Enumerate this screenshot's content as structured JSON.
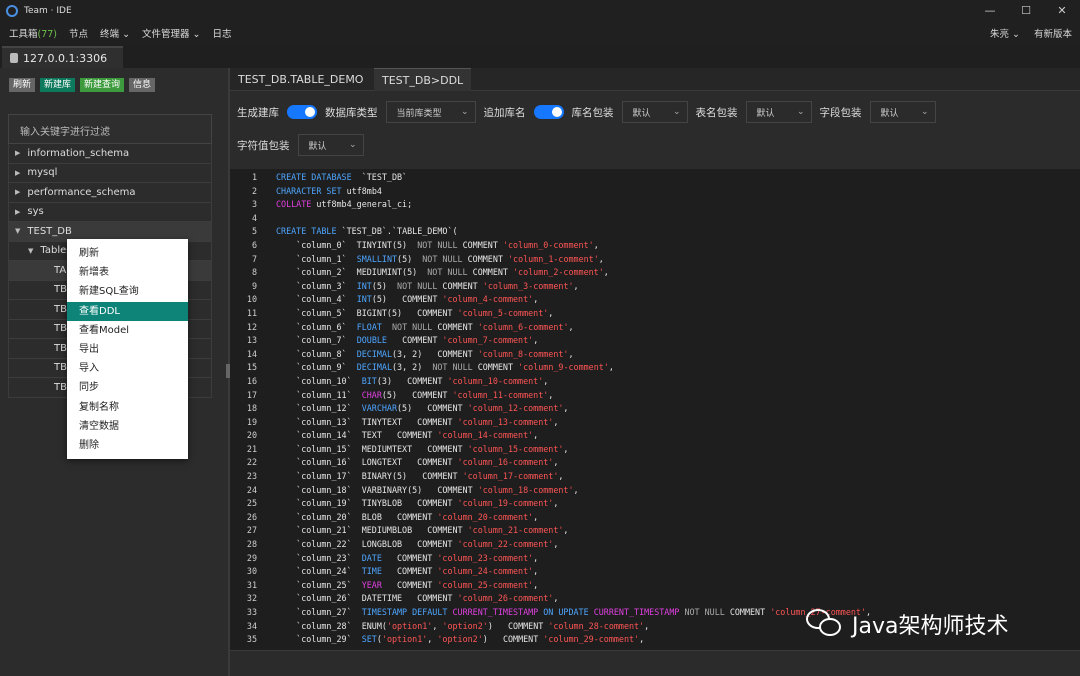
{
  "window": {
    "title": "Team · IDE",
    "controls": [
      "—",
      "☐",
      "✕"
    ]
  },
  "menu": {
    "items": [
      {
        "label": "工具箱",
        "count": "(77)"
      },
      {
        "label": "节点"
      },
      {
        "label": "终端 ⌄"
      },
      {
        "label": "文件管理器 ⌄"
      },
      {
        "label": "日志"
      }
    ],
    "user": "朱亮 ⌄",
    "update": "有新版本"
  },
  "connection_tab": "127.0.0.1:3306",
  "left": {
    "buttons": [
      "刷新",
      "新建库",
      "新建查询",
      "信息"
    ],
    "filter_placeholder": "输入关键字进行过滤",
    "tree": [
      {
        "label": "information_schema"
      },
      {
        "label": "mysql"
      },
      {
        "label": "performance_schema"
      },
      {
        "label": "sys"
      },
      {
        "label": "TEST_DB"
      },
      {
        "label": "Tables"
      },
      {
        "label": "TA"
      },
      {
        "label": "TB"
      },
      {
        "label": "TB"
      },
      {
        "label": "TB"
      },
      {
        "label": "TB"
      },
      {
        "label": "TB"
      },
      {
        "label": "TB"
      }
    ],
    "context_menu": [
      "刷新",
      "新增表",
      "新建SQL查询",
      "查看DDL",
      "查看Model",
      "导出",
      "导入",
      "同步",
      "复制名称",
      "清空数据",
      "删除"
    ]
  },
  "tabs": [
    "TEST_DB.TABLE_DEMO",
    "TEST_DB>DDL"
  ],
  "options": {
    "gen_db": "生成建库",
    "db_type": "数据库类型",
    "db_type_value": "当前库类型",
    "add_db_name": "追加库名",
    "db_wrap": "库名包装",
    "db_wrap_value": "默认",
    "table_wrap": "表名包装",
    "table_wrap_value": "默认",
    "field_wrap": "字段包装",
    "field_wrap_value": "默认",
    "char_wrap": "字符值包装",
    "char_wrap_value": "默认"
  },
  "code_lines": [
    [
      [
        "kw",
        "CREATE DATABASE"
      ],
      [
        "tx",
        "  `TEST_DB`"
      ]
    ],
    [
      [
        "kw",
        "CHARACTER SET"
      ],
      [
        "tx",
        " utf8mb4"
      ]
    ],
    [
      [
        "mg",
        "COLLATE"
      ],
      [
        "tx",
        " utf8mb4_general_ci;"
      ]
    ],
    [],
    [
      [
        "kw",
        "CREATE TABLE"
      ],
      [
        "tx",
        " `TEST_DB`.`TABLE_DEMO`("
      ]
    ],
    [
      [
        "tx",
        "    `column_0`  TINYINT(5)  "
      ],
      [
        "gr",
        "NOT NULL"
      ],
      [
        "tx",
        " COMMENT "
      ],
      [
        "st",
        "'column_0-comment'"
      ],
      [
        "tx",
        ","
      ]
    ],
    [
      [
        "tx",
        "    `column_1`  "
      ],
      [
        "kw",
        "SMALLINT"
      ],
      [
        "tx",
        "(5)  "
      ],
      [
        "gr",
        "NOT NULL"
      ],
      [
        "tx",
        " COMMENT "
      ],
      [
        "st",
        "'column_1-comment'"
      ],
      [
        "tx",
        ","
      ]
    ],
    [
      [
        "tx",
        "    `column_2`  MEDIUMINT(5)  "
      ],
      [
        "gr",
        "NOT NULL"
      ],
      [
        "tx",
        " COMMENT "
      ],
      [
        "st",
        "'column_2-comment'"
      ],
      [
        "tx",
        ","
      ]
    ],
    [
      [
        "tx",
        "    `column_3`  "
      ],
      [
        "kw",
        "INT"
      ],
      [
        "tx",
        "(5)  "
      ],
      [
        "gr",
        "NOT NULL"
      ],
      [
        "tx",
        " COMMENT "
      ],
      [
        "st",
        "'column_3-comment'"
      ],
      [
        "tx",
        ","
      ]
    ],
    [
      [
        "tx",
        "    `column_4`  "
      ],
      [
        "kw",
        "INT"
      ],
      [
        "tx",
        "(5)   COMMENT "
      ],
      [
        "st",
        "'column_4-comment'"
      ],
      [
        "tx",
        ","
      ]
    ],
    [
      [
        "tx",
        "    `column_5`  BIGINT(5)   COMMENT "
      ],
      [
        "st",
        "'column_5-comment'"
      ],
      [
        "tx",
        ","
      ]
    ],
    [
      [
        "tx",
        "    `column_6`  "
      ],
      [
        "kw",
        "FLOAT"
      ],
      [
        "tx",
        "  "
      ],
      [
        "gr",
        "NOT NULL"
      ],
      [
        "tx",
        " COMMENT "
      ],
      [
        "st",
        "'column_6-comment'"
      ],
      [
        "tx",
        ","
      ]
    ],
    [
      [
        "tx",
        "    `column_7`  "
      ],
      [
        "kw",
        "DOUBLE"
      ],
      [
        "tx",
        "   COMMENT "
      ],
      [
        "st",
        "'column_7-comment'"
      ],
      [
        "tx",
        ","
      ]
    ],
    [
      [
        "tx",
        "    `column_8`  "
      ],
      [
        "kw",
        "DECIMAL"
      ],
      [
        "tx",
        "(3, 2)   COMMENT "
      ],
      [
        "st",
        "'column_8-comment'"
      ],
      [
        "tx",
        ","
      ]
    ],
    [
      [
        "tx",
        "    `column_9`  "
      ],
      [
        "kw",
        "DECIMAL"
      ],
      [
        "tx",
        "(3, 2)  "
      ],
      [
        "gr",
        "NOT NULL"
      ],
      [
        "tx",
        " COMMENT "
      ],
      [
        "st",
        "'column_9-comment'"
      ],
      [
        "tx",
        ","
      ]
    ],
    [
      [
        "tx",
        "    `column_10`  "
      ],
      [
        "kw",
        "BIT"
      ],
      [
        "tx",
        "(3)   COMMENT "
      ],
      [
        "st",
        "'column_10-comment'"
      ],
      [
        "tx",
        ","
      ]
    ],
    [
      [
        "tx",
        "    `column_11`  "
      ],
      [
        "mg",
        "CHAR"
      ],
      [
        "tx",
        "(5)   COMMENT "
      ],
      [
        "st",
        "'column_11-comment'"
      ],
      [
        "tx",
        ","
      ]
    ],
    [
      [
        "tx",
        "    `column_12`  "
      ],
      [
        "kw",
        "VARCHAR"
      ],
      [
        "tx",
        "(5)   COMMENT "
      ],
      [
        "st",
        "'column_12-comment'"
      ],
      [
        "tx",
        ","
      ]
    ],
    [
      [
        "tx",
        "    `column_13`  TINYTEXT   COMMENT "
      ],
      [
        "st",
        "'column_13-comment'"
      ],
      [
        "tx",
        ","
      ]
    ],
    [
      [
        "tx",
        "    `column_14`  TEXT   COMMENT "
      ],
      [
        "st",
        "'column_14-comment'"
      ],
      [
        "tx",
        ","
      ]
    ],
    [
      [
        "tx",
        "    `column_15`  MEDIUMTEXT   COMMENT "
      ],
      [
        "st",
        "'column_15-comment'"
      ],
      [
        "tx",
        ","
      ]
    ],
    [
      [
        "tx",
        "    `column_16`  LONGTEXT   COMMENT "
      ],
      [
        "st",
        "'column_16-comment'"
      ],
      [
        "tx",
        ","
      ]
    ],
    [
      [
        "tx",
        "    `column_17`  BINARY(5)   COMMENT "
      ],
      [
        "st",
        "'column_17-comment'"
      ],
      [
        "tx",
        ","
      ]
    ],
    [
      [
        "tx",
        "    `column_18`  VARBINARY(5)   COMMENT "
      ],
      [
        "st",
        "'column_18-comment'"
      ],
      [
        "tx",
        ","
      ]
    ],
    [
      [
        "tx",
        "    `column_19`  TINYBLOB   COMMENT "
      ],
      [
        "st",
        "'column_19-comment'"
      ],
      [
        "tx",
        ","
      ]
    ],
    [
      [
        "tx",
        "    `column_20`  BLOB   COMMENT "
      ],
      [
        "st",
        "'column_20-comment'"
      ],
      [
        "tx",
        ","
      ]
    ],
    [
      [
        "tx",
        "    `column_21`  MEDIUMBLOB   COMMENT "
      ],
      [
        "st",
        "'column_21-comment'"
      ],
      [
        "tx",
        ","
      ]
    ],
    [
      [
        "tx",
        "    `column_22`  LONGBLOB   COMMENT "
      ],
      [
        "st",
        "'column_22-comment'"
      ],
      [
        "tx",
        ","
      ]
    ],
    [
      [
        "tx",
        "    `column_23`  "
      ],
      [
        "kw",
        "DATE"
      ],
      [
        "tx",
        "   COMMENT "
      ],
      [
        "st",
        "'column_23-comment'"
      ],
      [
        "tx",
        ","
      ]
    ],
    [
      [
        "tx",
        "    `column_24`  "
      ],
      [
        "kw",
        "TIME"
      ],
      [
        "tx",
        "   COMMENT "
      ],
      [
        "st",
        "'column_24-comment'"
      ],
      [
        "tx",
        ","
      ]
    ],
    [
      [
        "tx",
        "    `column_25`  "
      ],
      [
        "mg",
        "YEAR"
      ],
      [
        "tx",
        "   COMMENT "
      ],
      [
        "st",
        "'column_25-comment'"
      ],
      [
        "tx",
        ","
      ]
    ],
    [
      [
        "tx",
        "    `column_26`  DATETIME   COMMENT "
      ],
      [
        "st",
        "'column_26-comment'"
      ],
      [
        "tx",
        ","
      ]
    ],
    [
      [
        "tx",
        "    `column_27`  "
      ],
      [
        "kw",
        "TIMESTAMP DEFAULT"
      ],
      [
        "tx",
        " "
      ],
      [
        "mg",
        "CURRENT_TIMESTAMP"
      ],
      [
        "tx",
        " "
      ],
      [
        "kw",
        "ON UPDATE"
      ],
      [
        "tx",
        " "
      ],
      [
        "mg",
        "CURRENT_TIMESTAMP"
      ],
      [
        "tx",
        " "
      ],
      [
        "gr",
        "NOT NULL"
      ],
      [
        "tx",
        " COMMENT "
      ],
      [
        "st",
        "'column_27-comment'"
      ],
      [
        "tx",
        ","
      ]
    ],
    [
      [
        "tx",
        "    `column_28`  ENUM("
      ],
      [
        "st",
        "'option1'"
      ],
      [
        "tx",
        ", "
      ],
      [
        "st",
        "'option2'"
      ],
      [
        "tx",
        ")   COMMENT "
      ],
      [
        "st",
        "'column_28-comment'"
      ],
      [
        "tx",
        ","
      ]
    ],
    [
      [
        "tx",
        "    `column_29`  "
      ],
      [
        "kw",
        "SET"
      ],
      [
        "tx",
        "("
      ],
      [
        "st",
        "'option1'"
      ],
      [
        "tx",
        ", "
      ],
      [
        "st",
        "'option2'"
      ],
      [
        "tx",
        ")   COMMENT "
      ],
      [
        "st",
        "'column_29-comment'"
      ],
      [
        "tx",
        ","
      ]
    ]
  ],
  "watermark": "Java架构师技术"
}
